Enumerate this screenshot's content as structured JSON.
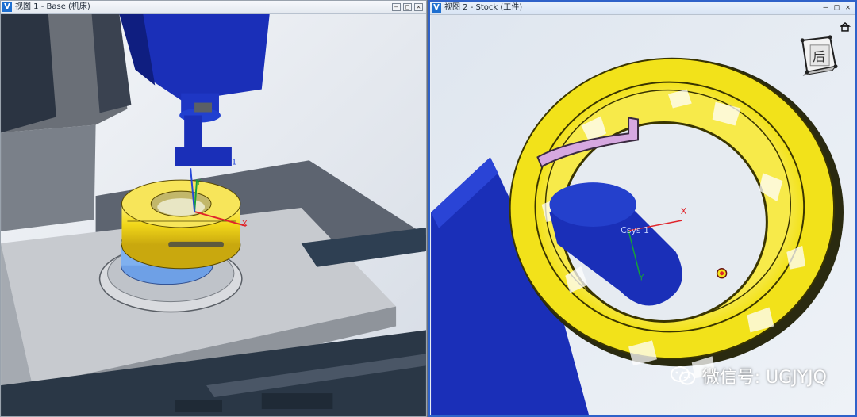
{
  "windows": {
    "left": {
      "title": "视图 1 - Base (机床)",
      "logo": "V"
    },
    "right": {
      "title": "视图 2 - Stock (工件)",
      "logo": "V"
    }
  },
  "window_controls": {
    "minimize": "—",
    "restore": "□",
    "close": "✕"
  },
  "scene_labels": {
    "left_csys": "1",
    "left_axis_x": "X",
    "left_axis_y": "Y",
    "right_csys": "Csys 1",
    "right_axis_x": "X",
    "right_axis_y": "Y"
  },
  "view_cube": {
    "face_label": "后",
    "home_icon": "home-icon"
  },
  "watermark": {
    "text": "微信号: UGJYJQ",
    "icon": "wechat-icon"
  },
  "colors": {
    "stock_yellow": "#f2e21a",
    "machine_blue": "#1a2fb8",
    "axis_x": "#e0242b",
    "axis_y": "#16a03a",
    "selection_border": "#2f62c9"
  }
}
